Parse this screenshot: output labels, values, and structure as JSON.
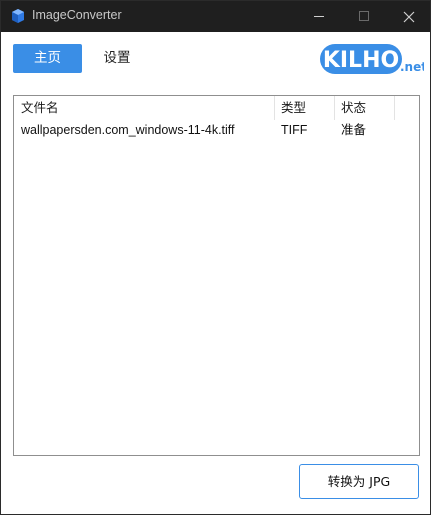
{
  "window": {
    "title": "ImageConverter",
    "app_icon": "app-icon"
  },
  "nav": {
    "tabs": [
      {
        "label": "主页",
        "active": true
      },
      {
        "label": "设置",
        "active": false
      }
    ]
  },
  "logo": {
    "main_text": "KILHO",
    "suffix_text": ".net",
    "color": "#3a8ee6"
  },
  "file_list": {
    "columns": [
      "文件名",
      "类型",
      "状态"
    ],
    "rows": [
      {
        "name": "wallpapersden.com_windows-11-4k.tiff",
        "type": "TIFF",
        "status": "准备"
      }
    ]
  },
  "actions": {
    "convert_label": "转换为 JPG"
  },
  "colors": {
    "accent": "#3a8ee6",
    "titlebar": "#1f1f1f"
  }
}
